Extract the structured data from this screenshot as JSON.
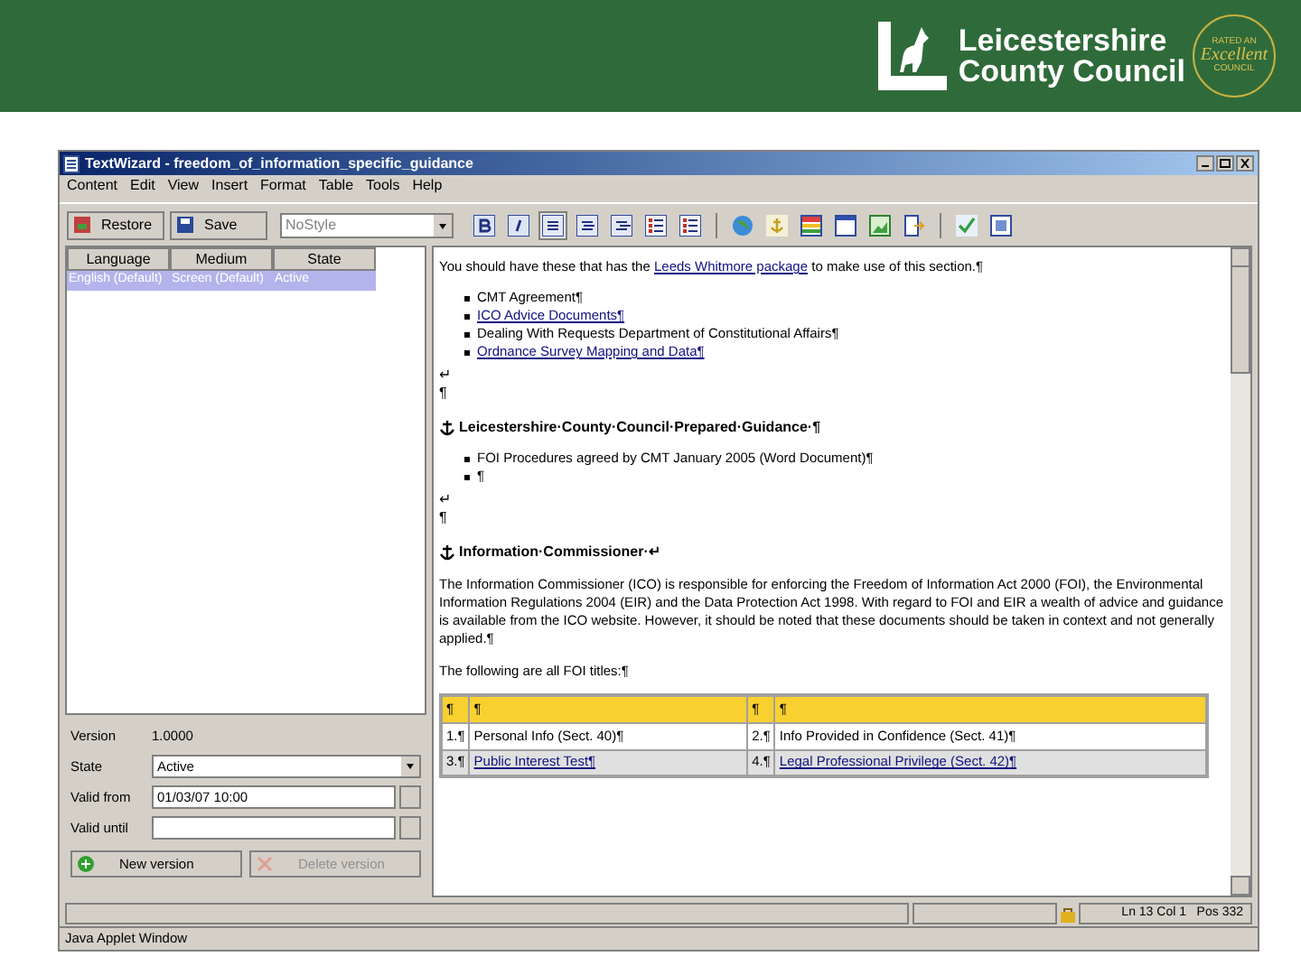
{
  "logo": {
    "name_line_1": "Leicestershire",
    "name_line_2": "County Council",
    "badge_top": "RATED AN",
    "badge_middle": "Excellent",
    "badge_bottom": "COUNCIL"
  },
  "window": {
    "title": "TextWizard - freedom_of_information_specific_guidance"
  },
  "menu": [
    "Content",
    "Edit",
    "View",
    "Insert",
    "Format",
    "Table",
    "Tools",
    "Help"
  ],
  "toolbar": {
    "restore": "Restore",
    "save": "Save",
    "style": "NoStyle",
    "buttons": [
      {
        "kind": "bold",
        "selected": false
      },
      {
        "kind": "italic",
        "selected": false
      },
      {
        "kind": "align_left",
        "selected": true
      },
      {
        "kind": "align_center",
        "selected": false
      },
      {
        "kind": "align_right",
        "selected": false
      },
      {
        "kind": "numbered_list",
        "selected": false
      },
      {
        "kind": "bullet_list",
        "selected": false
      },
      {
        "kind": "link",
        "selected": false
      },
      {
        "kind": "anchor",
        "selected": false
      },
      {
        "kind": "table",
        "selected": false
      },
      {
        "kind": "frame",
        "selected": false
      },
      {
        "kind": "image",
        "selected": false
      },
      {
        "kind": "export",
        "selected": false
      },
      {
        "kind": "spellcheck",
        "selected": false
      },
      {
        "kind": "properties",
        "selected": false
      }
    ]
  },
  "versions_table": {
    "columns": [
      "Language",
      "Medium",
      "State"
    ],
    "rows": [
      {
        "cells": [
          "English (Default)",
          "Screen (Default)",
          "Active"
        ],
        "selected": true
      }
    ]
  },
  "version_form": {
    "version_label": "Version",
    "version": "1.0000",
    "state_label": "State",
    "state": "Active",
    "valid_from_label": "Valid from",
    "valid_from": "01/03/07 10:00",
    "valid_until_label": "Valid until",
    "new_button": "New version",
    "delete_button": "Delete version",
    "delete_disabled": true
  },
  "editor": {
    "blocks": [
      {
        "kind": "para",
        "parts": [
          {
            "text": "You should have these that has the "
          },
          {
            "text": "Leeds Whitmore package",
            "link": true
          },
          {
            "text": " to make use of this section.¶"
          }
        ]
      },
      {
        "kind": "bullets",
        "items": [
          {
            "text": "CMT Agreement¶",
            "link": false
          },
          {
            "text": "ICO Advice Documents¶",
            "link": true
          },
          {
            "text": "Dealing With Requests Department of Constitutional Affairs¶",
            "link": false
          },
          {
            "text": "Ordnance Survey Mapping and Data¶",
            "link": true
          }
        ]
      },
      {
        "kind": "mark",
        "text": "↵"
      },
      {
        "kind": "mark",
        "text": "¶"
      },
      {
        "kind": "heading",
        "text": "Leicestershire·County·Council·Prepared·Guidance·¶"
      },
      {
        "kind": "bullets",
        "items": [
          {
            "text": "FOI Procedures agreed by CMT January 2005 (Word Document)¶",
            "link": false
          },
          {
            "text": "¶",
            "link": false
          }
        ]
      },
      {
        "kind": "mark",
        "text": "↵"
      },
      {
        "kind": "mark",
        "text": "¶"
      },
      {
        "kind": "heading",
        "text": "Information·Commissioner·↵"
      },
      {
        "kind": "para",
        "parts": [
          {
            "text": "The Information Commissioner (ICO) is responsible for enforcing the Freedom of Information Act 2000 (FOI), the Environmental Information Regulations 2004 (EIR) and the Data Protection Act 1998. With regard to FOI and EIR a wealth of advice and guidance is available from the ICO website. However, it should be noted that these documents should be taken in context and not generally applied.¶"
          }
        ]
      },
      {
        "kind": "para",
        "parts": [
          {
            "text": "The following are all FOI titles:¶"
          }
        ]
      },
      {
        "kind": "table",
        "rows": [
          {
            "header": true,
            "cells": [
              {
                "text": "¶"
              },
              {
                "text": "¶"
              },
              {
                "text": "¶"
              },
              {
                "text": "¶"
              }
            ]
          },
          {
            "header": false,
            "cells": [
              {
                "text": "1.¶"
              },
              {
                "text": "Personal Info (Sect. 40)¶"
              },
              {
                "text": "2.¶"
              },
              {
                "text": "Info Provided in Confidence (Sect. 41)¶"
              }
            ]
          },
          {
            "header": false,
            "cells": [
              {
                "text": "3.¶"
              },
              {
                "text": "Public Interest Test¶",
                "link": true
              },
              {
                "text": "4.¶"
              },
              {
                "text": "Legal Professional Privilege (Sect. 42)¶",
                "link": true
              }
            ]
          }
        ]
      }
    ]
  },
  "status_bar": {
    "position": "Ln 13 Col 1   Pos 332"
  },
  "footer": "Java Applet Window"
}
